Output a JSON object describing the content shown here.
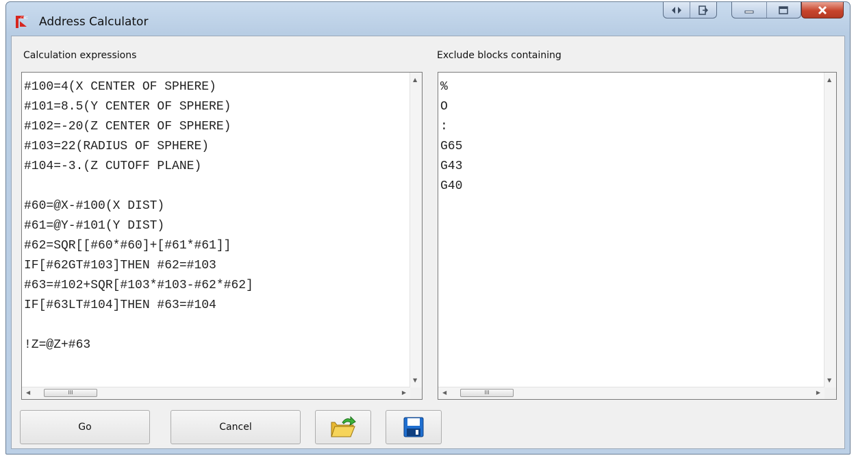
{
  "window": {
    "title": "Address Calculator",
    "app_icon": "cnc-app-icon"
  },
  "captions": {
    "extra_icons": [
      "code-icon",
      "export-icon"
    ],
    "system_icons": [
      "minimize-icon",
      "maximize-icon",
      "close-icon"
    ]
  },
  "left_panel": {
    "label": "Calculation expressions",
    "content": "#100=4(X CENTER OF SPHERE)\n#101=8.5(Y CENTER OF SPHERE)\n#102=-20(Z CENTER OF SPHERE)\n#103=22(RADIUS OF SPHERE)\n#104=-3.(Z CUTOFF PLANE)\n\n#60=@X-#100(X DIST)\n#61=@Y-#101(Y DIST)\n#62=SQR[[#60*#60]+[#61*#61]]\nIF[#62GT#103]THEN #62=#103\n#63=#102+SQR[#103*#103-#62*#62]\nIF[#63LT#104]THEN #63=#104\n\n!Z=@Z+#63"
  },
  "right_panel": {
    "label": "Exclude blocks containing",
    "content": "%\nO\n:\nG65\nG43\nG40"
  },
  "scroll": {
    "thumb_grip": "III"
  },
  "buttons": {
    "go": "Go",
    "cancel": "Cancel",
    "open_icon": "open-folder-icon",
    "save_icon": "save-disk-icon"
  }
}
